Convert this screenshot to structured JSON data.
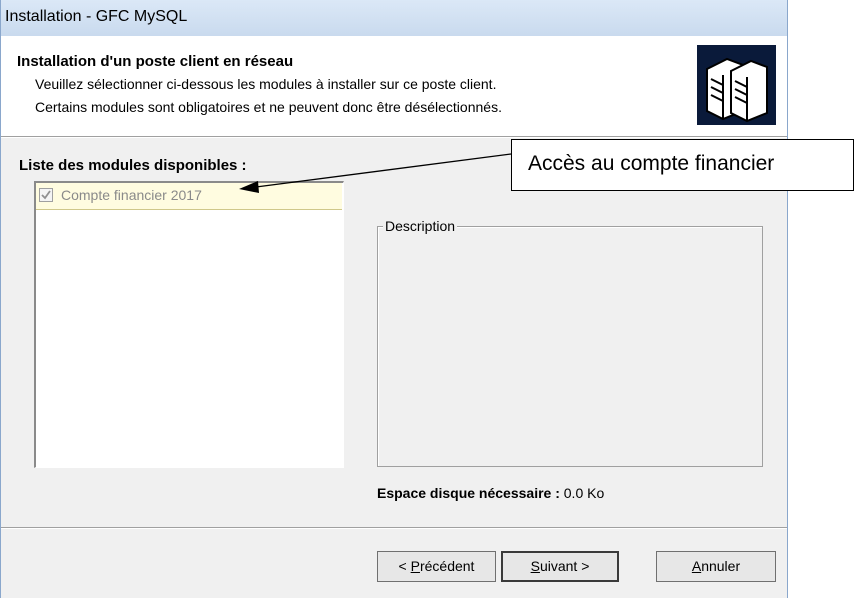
{
  "window": {
    "title": "Installation - GFC MySQL"
  },
  "header": {
    "title": "Installation d'un poste client en réseau",
    "line1": "Veuillez sélectionner ci-dessous les modules à installer sur ce poste client.",
    "line2": "Certains modules sont obligatoires et ne peuvent donc être désélectionnés.",
    "logo_icon": "servers-icon"
  },
  "modules": {
    "label": "Liste des modules disponibles :",
    "items": [
      {
        "label": "Compte financier 2017",
        "checked": true,
        "disabled": true
      }
    ]
  },
  "description": {
    "legend": "Description"
  },
  "disk": {
    "label": "Espace disque nécessaire :",
    "value": "0.0 Ko"
  },
  "buttons": {
    "prev_prefix": "< ",
    "prev_accel": "P",
    "prev_rest": "récédent",
    "next_accel": "S",
    "next_rest": "uivant >",
    "cancel_accel": "A",
    "cancel_rest": "nnuler"
  },
  "callout": {
    "text": "Accès au compte financier"
  },
  "colors": {
    "titlebar": "#c9daee",
    "selected_item_bg": "#fffce0",
    "logo_bg": "#0a1a3a"
  }
}
